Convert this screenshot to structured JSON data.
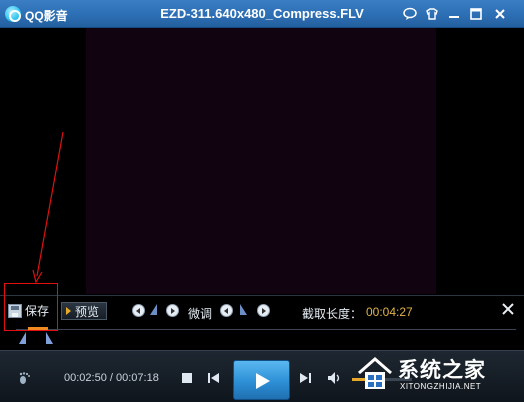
{
  "window": {
    "app_name": "QQ影音",
    "file_title": "EZD-311.640x480_Compress.FLV",
    "buttons": [
      "chat-icon",
      "skin-icon",
      "minimize-icon",
      "maximize-icon",
      "close-icon"
    ]
  },
  "clip_toolbar": {
    "save_label": "保存",
    "preview_label": "预览",
    "fine_tune_label": "微调",
    "clip_length_label": "截取长度：",
    "clip_length_value": "00:04:27"
  },
  "playback": {
    "current_time": "00:02:50",
    "separator": " / ",
    "total_time": "00:07:18",
    "volume_level": 0.4
  },
  "watermark": {
    "brand_text": "系统之家",
    "site_text": "XITONGZHIJIA.NET"
  },
  "colors": {
    "title_bar": "#2d6fb4",
    "accent_orange": "#e0b44a",
    "annotation_red": "#e01010",
    "video_bg": "#11030f"
  }
}
